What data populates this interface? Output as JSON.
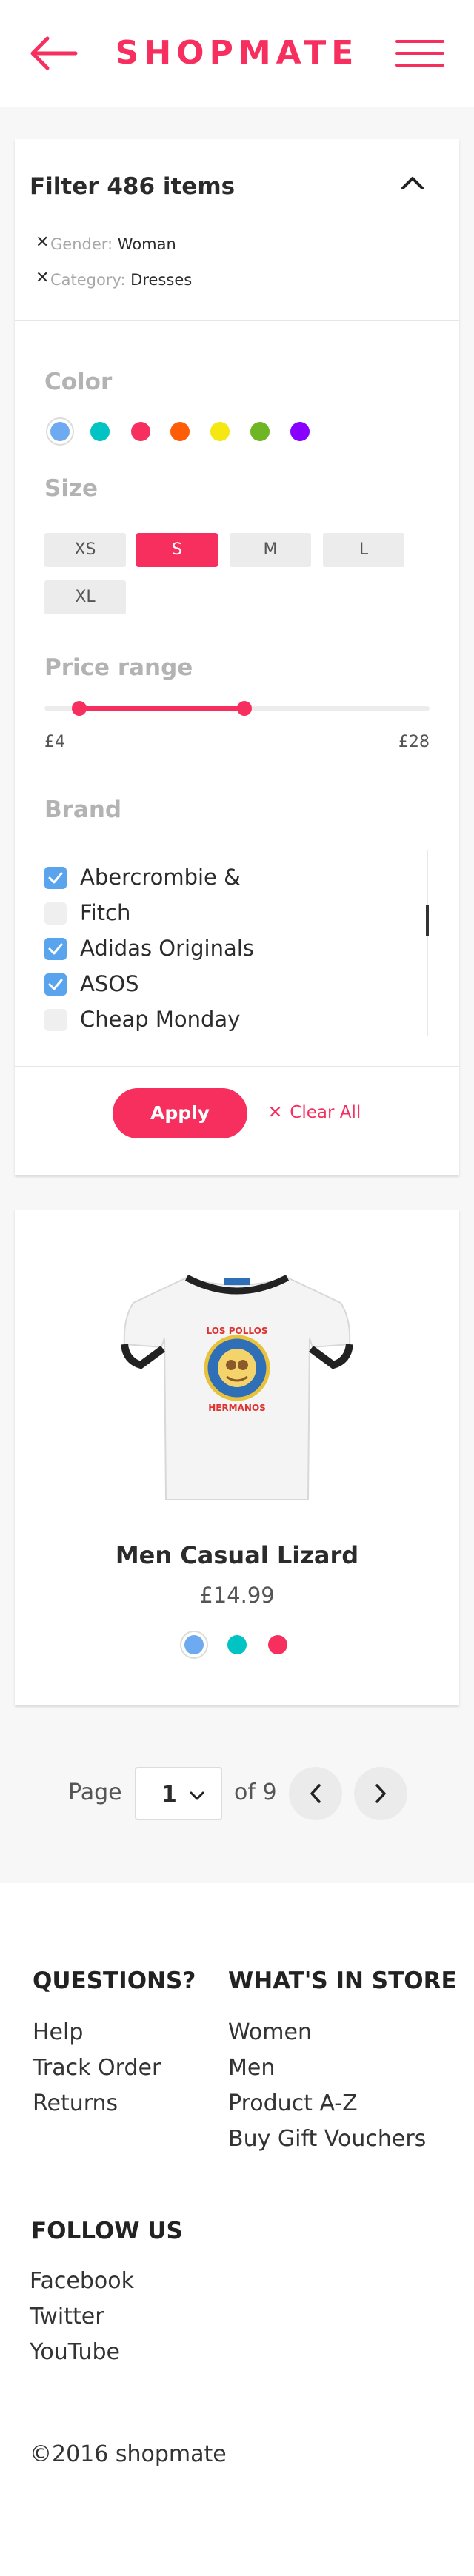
{
  "header": {
    "brand": "SHOPMATE"
  },
  "filter": {
    "title": "Filter 486 items",
    "tags": [
      {
        "key": "Gender:",
        "value": "Woman"
      },
      {
        "key": "Category:",
        "value": "Dresses"
      }
    ],
    "color_label": "Color",
    "colors": [
      "#6eaaf0",
      "#00c3c3",
      "#f62f5e",
      "#fe5c07",
      "#f5e711",
      "#6eb624",
      "#8800ff"
    ],
    "selected_color": "#6eaaf0",
    "size_label": "Size",
    "sizes": [
      "XS",
      "S",
      "M",
      "L",
      "XL"
    ],
    "selected_size": "S",
    "price_label": "Price range",
    "price_min": "£4",
    "price_max": "£28",
    "price_range_fraction": [
      0.09,
      0.52
    ],
    "brand_label": "Brand",
    "brands": [
      {
        "label": "Abercrombie &",
        "checked": true
      },
      {
        "label": "Fitch",
        "checked": false
      },
      {
        "label": "Adidas Originals",
        "checked": true
      },
      {
        "label": "ASOS",
        "checked": true
      },
      {
        "label": "Cheap Monday",
        "checked": false
      }
    ],
    "apply_label": "Apply",
    "clear_label": "Clear All"
  },
  "product": {
    "name": "Men Casual Lizard",
    "price": "£14.99",
    "print_text_top": "LOS POLLOS",
    "print_text_bottom": "HERMANOS",
    "colors": [
      "#6eaaf0",
      "#00c3c3",
      "#f62f5e"
    ]
  },
  "pagination": {
    "page_label": "Page",
    "current_page": "1",
    "of_label": "of 9"
  },
  "footer": {
    "questions": {
      "heading": "QUESTIONS?",
      "links": [
        "Help",
        "Track Order",
        "Returns"
      ]
    },
    "store": {
      "heading": "WHAT'S IN STORE",
      "links": [
        "Women",
        "Men",
        "Product A-Z",
        "Buy Gift Vouchers"
      ]
    },
    "follow": {
      "heading": "FOLLOW US",
      "links": [
        "Facebook",
        "Twitter",
        "YouTube"
      ]
    },
    "copyright": "©2016 shopmate"
  }
}
